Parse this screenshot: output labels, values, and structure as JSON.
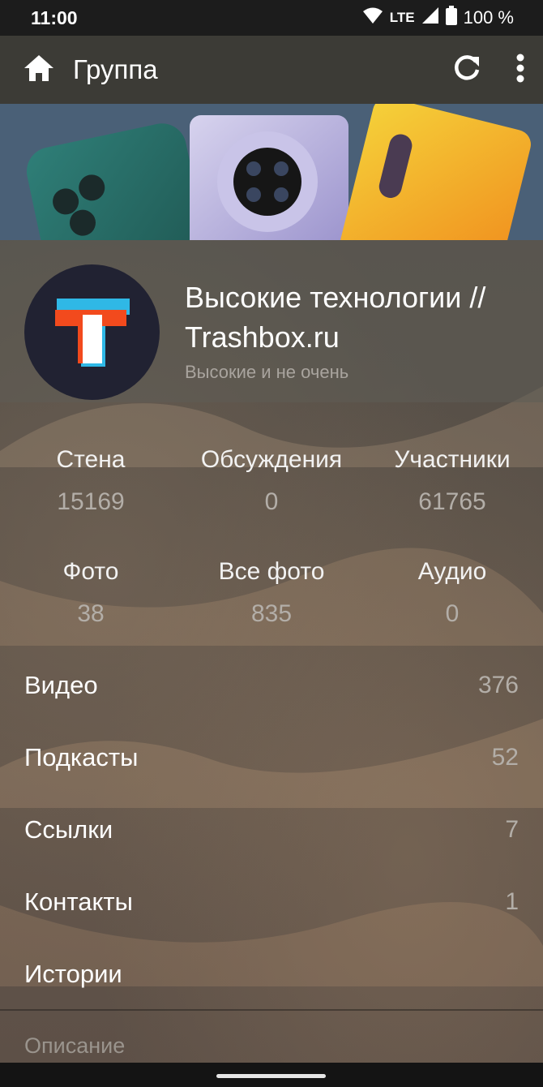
{
  "status_bar": {
    "time": "11:00",
    "network": "LTE",
    "battery": "100 %"
  },
  "app_bar": {
    "title": "Группа"
  },
  "group": {
    "name": "Высокие технологии // Trashbox.ru",
    "description_short": "Высокие и не очень"
  },
  "stats_row1": [
    {
      "label": "Стена",
      "value": "15169"
    },
    {
      "label": "Обсуждения",
      "value": "0"
    },
    {
      "label": "Участники",
      "value": "61765"
    }
  ],
  "stats_row2": [
    {
      "label": "Фото",
      "value": "38"
    },
    {
      "label": "Все фото",
      "value": "835"
    },
    {
      "label": "Аудио",
      "value": "0"
    }
  ],
  "list": [
    {
      "label": "Видео",
      "value": "376"
    },
    {
      "label": "Подкасты",
      "value": "52"
    },
    {
      "label": "Ссылки",
      "value": "7"
    },
    {
      "label": "Контакты",
      "value": "1"
    },
    {
      "label": "Истории",
      "value": ""
    }
  ],
  "description_label": "Описание",
  "icons": {
    "home": "home-icon",
    "refresh": "refresh-icon",
    "more": "more-vert-icon",
    "wifi": "wifi-icon",
    "signal": "signal-icon",
    "battery": "battery-icon"
  },
  "colors": {
    "logo_orange": "#f24a1d",
    "logo_blue": "#2fb8e6",
    "avatar_bg": "#212232"
  }
}
